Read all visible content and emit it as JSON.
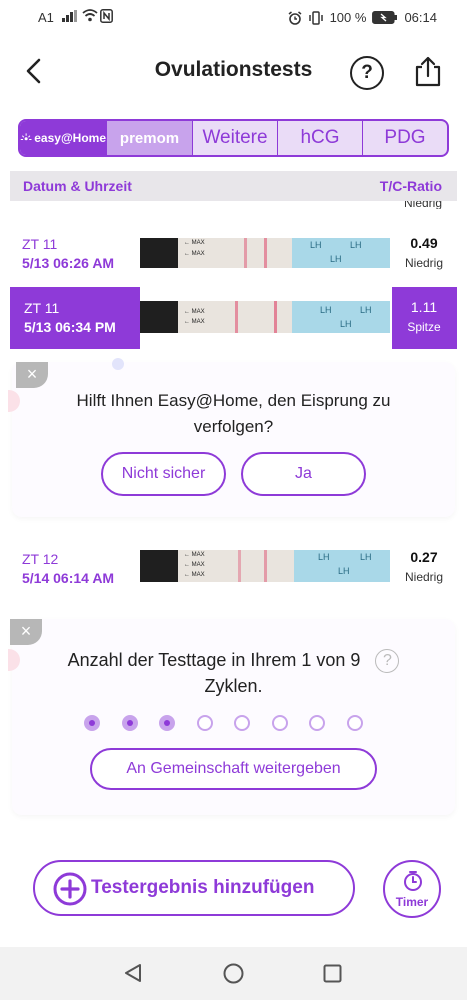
{
  "status_bar": {
    "carrier": "A1",
    "battery": "100 %",
    "time": "06:14"
  },
  "header": {
    "title": "Ovulationstests",
    "help_symbol": "?"
  },
  "tabs": [
    {
      "label": "easy@Home",
      "selected": true
    },
    {
      "label": "premom",
      "selected": false
    },
    {
      "label": "Weitere",
      "selected": false
    },
    {
      "label": "hCG",
      "selected": false
    },
    {
      "label": "PDG",
      "selected": false
    }
  ],
  "table": {
    "col_date": "Datum & Uhrzeit",
    "col_ratio": "T/C-Ratio",
    "cut_top_text": "Niedrig",
    "rows": [
      {
        "cycle_day": "ZT 11",
        "datetime": "5/13   06:26 AM",
        "ratio": "0.49",
        "level": "Niedrig",
        "highlighted": false
      },
      {
        "cycle_day": "ZT 11",
        "datetime": "5/13   06:34 PM",
        "ratio": "1.11",
        "level": "Spitze",
        "highlighted": true
      },
      {
        "cycle_day": "ZT 12",
        "datetime": "5/14   06:14 AM",
        "ratio": "0.27",
        "level": "Niedrig",
        "highlighted": false
      }
    ],
    "strip_max_label": "← MAX",
    "strip_lh_label": "LH"
  },
  "survey_card": {
    "close_symbol": "×",
    "question": "Hilft Ihnen Easy@Home, den Eisprung zu verfolgen?",
    "option_unsure": "Nicht sicher",
    "option_yes": "Ja"
  },
  "cycle_card": {
    "close_symbol": "×",
    "text_line1": "Anzahl der Testtage in Ihrem 1 von 9",
    "text_line2": "Zyklen.",
    "help_symbol": "?",
    "progress_filled": 3,
    "progress_total": 8,
    "share_button": "An Gemeinschaft weitergeben"
  },
  "footer": {
    "add_result": "Testergebnis hinzufügen",
    "timer": "Timer"
  },
  "colors": {
    "accent": "#8e3ad8",
    "accent_light": "#c8a3ec",
    "tab_bg": "#eadcf7"
  }
}
